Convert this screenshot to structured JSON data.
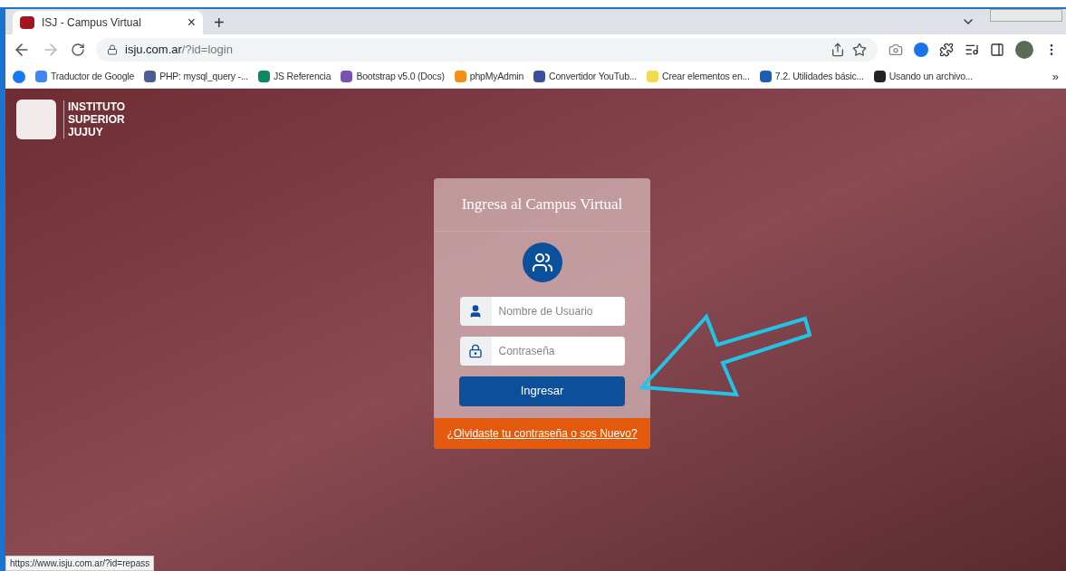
{
  "browser": {
    "tab": {
      "title": "ISJ - Campus Virtual",
      "close": "×"
    },
    "new_tab": "+",
    "url": {
      "host": "isju.com.ar",
      "path": "/?id=login"
    },
    "bookmarks": [
      {
        "label": "Traductor de Google"
      },
      {
        "label": "PHP: mysql_query -..."
      },
      {
        "label": "JS Referencia"
      },
      {
        "label": "Bootstrap v5.0 (Docs)"
      },
      {
        "label": "phpMyAdmin"
      },
      {
        "label": "Convertidor YouTub..."
      },
      {
        "label": "Crear elementos en..."
      },
      {
        "label": "7.2. Utilidades básic..."
      },
      {
        "label": "Usando un archivo..."
      }
    ],
    "more": "»"
  },
  "logo": {
    "lines": [
      "INSTITUTO",
      "SUPERIOR",
      "JUJUY"
    ]
  },
  "login": {
    "title": "Ingresa al Campus Virtual",
    "username": {
      "placeholder": "Nombre de Usuario"
    },
    "password": {
      "placeholder": "Contraseña"
    },
    "submit": "Ingresar",
    "forgot_link": "¿Olvidaste tu contraseña o sos Nuevo?"
  },
  "status_url": "https://www.isju.com.ar/?id=repass"
}
